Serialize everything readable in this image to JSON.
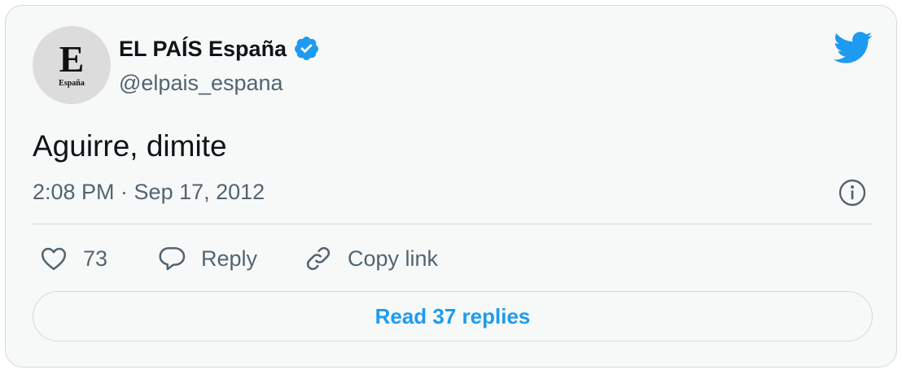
{
  "author": {
    "name": "EL PAÍS España",
    "handle": "@elpais_espana",
    "avatar_letter": "E",
    "avatar_subtext": "España",
    "verified": true
  },
  "tweet": {
    "text": "Aguirre, dimite",
    "timestamp": "2:08 PM · Sep 17, 2012"
  },
  "actions": {
    "like_count": "73",
    "reply_label": "Reply",
    "copy_link_label": "Copy link"
  },
  "read_replies_label": "Read 37 replies",
  "colors": {
    "accent": "#1d9bf0",
    "secondary_text": "#536471",
    "border": "#cfd9de",
    "card_background": "#f7f9f9"
  },
  "icons": [
    "verified-badge-icon",
    "twitter-bird-icon",
    "info-icon",
    "heart-icon",
    "reply-bubble-icon",
    "link-icon"
  ]
}
